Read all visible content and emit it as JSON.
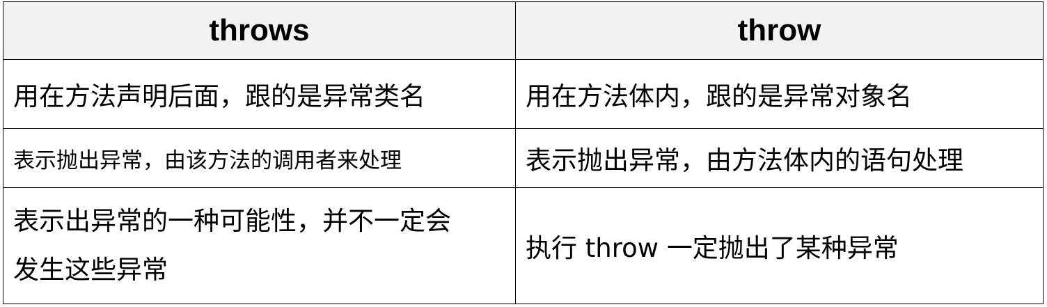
{
  "table": {
    "headers": [
      "throws",
      "throw"
    ],
    "rows": [
      [
        "用在方法声明后面，跟的是异常类名",
        "用在方法体内，跟的是异常对象名"
      ],
      [
        "表示抛出异常，由该方法的调用者来处理",
        "表示抛出异常，由方法体内的语句处理"
      ],
      [
        [
          "表示出异常的一种可能性，并不一定会",
          "发生这些异常"
        ],
        "执行 throw 一定抛出了某种异常"
      ]
    ]
  }
}
